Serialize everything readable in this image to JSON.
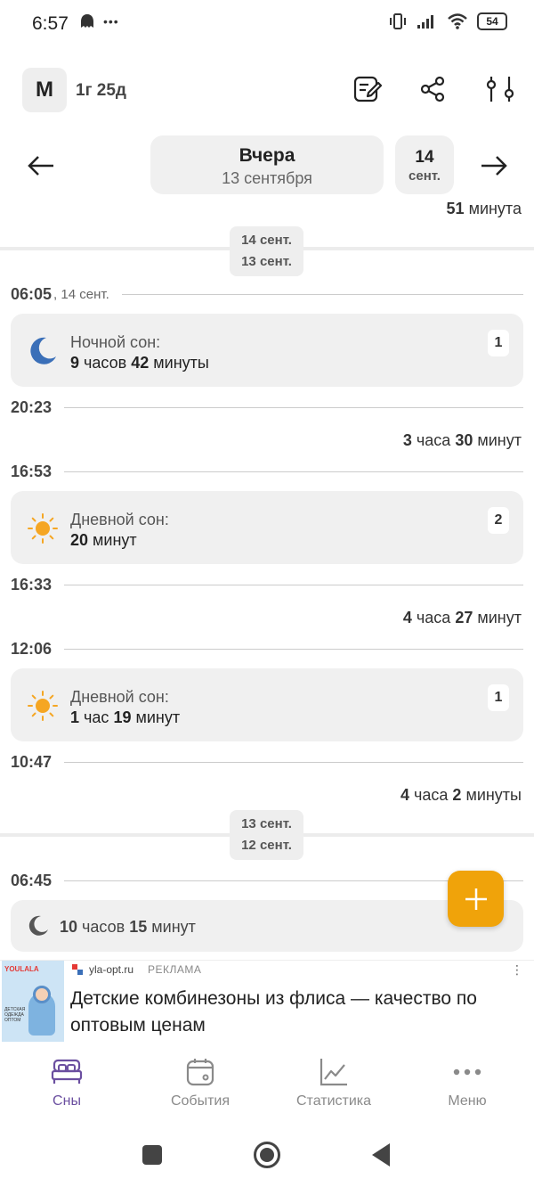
{
  "status_bar": {
    "time": "6:57",
    "dots": "•••",
    "battery": "54"
  },
  "header": {
    "avatar_letter": "M",
    "age": "1г 25д"
  },
  "date_nav": {
    "main_title": "Вчера",
    "main_subtitle": "13 сентября",
    "next_day": "14",
    "next_month": "сент."
  },
  "timeline": {
    "top_duration": {
      "num": "51",
      "unit": "минута"
    },
    "divider1": {
      "top": "14 сент.",
      "bottom": "13 сент."
    },
    "t1": {
      "time": "06:05",
      "suffix": ", 14 сент."
    },
    "card1": {
      "label": "Ночной сон:",
      "h": "9",
      "h_unit": "часов",
      "m": "42",
      "m_unit": "минуты",
      "badge": "1"
    },
    "t2": {
      "time": "20:23"
    },
    "gap1": {
      "h": "3",
      "h_unit": "часа",
      "m": "30",
      "m_unit": "минут"
    },
    "t3": {
      "time": "16:53"
    },
    "card2": {
      "label": "Дневной сон:",
      "m": "20",
      "m_unit": "минут",
      "badge": "2"
    },
    "t4": {
      "time": "16:33"
    },
    "gap2": {
      "h": "4",
      "h_unit": "часа",
      "m": "27",
      "m_unit": "минут"
    },
    "t5": {
      "time": "12:06"
    },
    "card3": {
      "label": "Дневной сон:",
      "h": "1",
      "h_unit": "час",
      "m": "19",
      "m_unit": "минут",
      "badge": "1"
    },
    "t6": {
      "time": "10:47"
    },
    "gap3": {
      "h": "4",
      "h_unit": "часа",
      "m": "2",
      "m_unit": "минуты"
    },
    "divider2": {
      "top": "13 сент.",
      "bottom": "12 сент."
    },
    "t7": {
      "time": "06:45"
    },
    "card4": {
      "h": "10",
      "h_unit": "часов",
      "m": "15",
      "m_unit": "минут"
    }
  },
  "ad": {
    "domain": "yla-opt.ru",
    "label": "РЕКЛАМА",
    "title": "Детские комбинезоны из флиса — качество по оптовым ценам",
    "image_brand": "YOULALA",
    "image_text": "ДЕТСКАЯ ОДЕЖДА ОПТОМ"
  },
  "bottom_nav": {
    "items": [
      {
        "label": "Сны"
      },
      {
        "label": "События"
      },
      {
        "label": "Статистика"
      },
      {
        "label": "Меню"
      }
    ]
  },
  "colors": {
    "accent": "#f0a30a",
    "active_nav": "#6b4fa0",
    "moon": "#3a6fb8",
    "sun": "#f5a623"
  }
}
